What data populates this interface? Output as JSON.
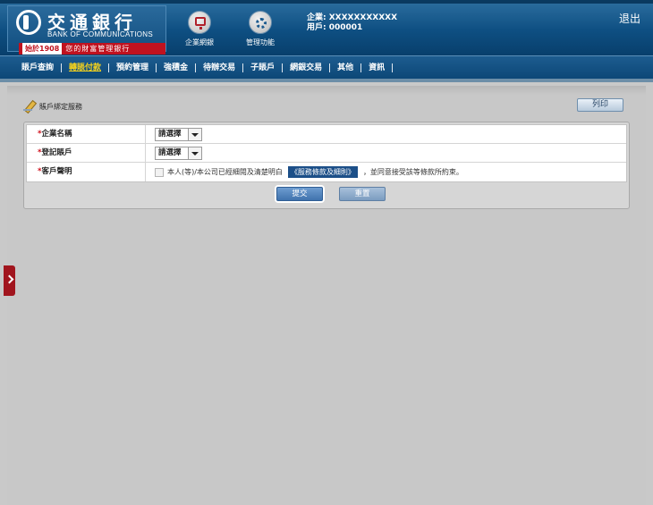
{
  "brand": {
    "name_cn": "交通銀行",
    "name_en": "BANK OF COMMUNICATIONS",
    "since": "始於1908",
    "slogan": "您的財富管理銀行"
  },
  "header_nav": [
    {
      "label": "企業網銀",
      "icon": "monitor-icon"
    },
    {
      "label": "管理功能",
      "icon": "gear-icon"
    }
  ],
  "user": {
    "company": "企業: XXXXXXXXXXX",
    "user_id": "用戶: 000001"
  },
  "logout_label": "退出",
  "menu": [
    {
      "label": "賬戶查詢",
      "active": false
    },
    {
      "label": "轉賬付款",
      "active": true
    },
    {
      "label": "預約管理",
      "active": false
    },
    {
      "label": "強積金",
      "active": false
    },
    {
      "label": "待辦交易",
      "active": false
    },
    {
      "label": "子賬戶",
      "active": false
    },
    {
      "label": "網銀交易",
      "active": false
    },
    {
      "label": "其他",
      "active": false
    },
    {
      "label": "資訊",
      "active": false
    }
  ],
  "page": {
    "title": "賬戶綁定服務",
    "print_label": "列印"
  },
  "form": {
    "company_name_label": "企業名稱",
    "company_name_value": "請選擇",
    "account_label": "登記賬戶",
    "account_value": "請選擇",
    "declaration_label": "客戶聲明",
    "declaration_text": "本人(等)/本公司已經細閱及清楚明白",
    "terms_link": "《服務條款及細則》",
    "declaration_tail": "，並同意接受該等條款所約束。",
    "required_mark": "*"
  },
  "buttons": {
    "submit": "提交",
    "reset": "重置"
  },
  "colors": {
    "header": "#0e4f82",
    "accent_red": "#c0121f",
    "active_menu": "#f5d21c"
  }
}
